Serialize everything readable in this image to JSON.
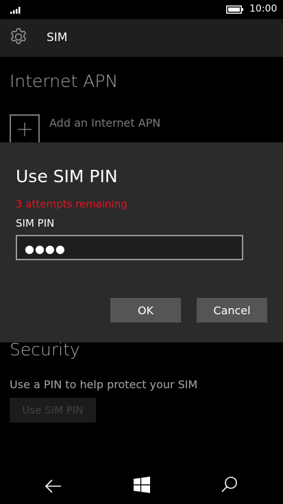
{
  "status_bar": {
    "time": "10:00",
    "icons": [
      "signal-icon",
      "battery-icon"
    ]
  },
  "header": {
    "icon": "gear-icon",
    "title": "SIM"
  },
  "internet_apn": {
    "title": "Internet APN",
    "add_label": "Add an Internet APN",
    "add_icon": "plus-icon"
  },
  "security": {
    "title": "Security",
    "description": "Use a PIN to help protect your SIM",
    "button_label": "Use SIM PIN"
  },
  "dialog": {
    "title": "Use SIM PIN",
    "warning": "3 attempts remaining",
    "field_label": "SIM PIN",
    "pin_masked": "●●●●",
    "ok_label": "OK",
    "cancel_label": "Cancel",
    "warning_color": "#e81123"
  },
  "navbar": {
    "icons": [
      "back-arrow-icon",
      "windows-start-icon",
      "search-icon"
    ]
  },
  "colors": {
    "background": "#000000",
    "header": "#1f1f1f",
    "dialog": "#2b2b2b",
    "button": "#555555"
  }
}
